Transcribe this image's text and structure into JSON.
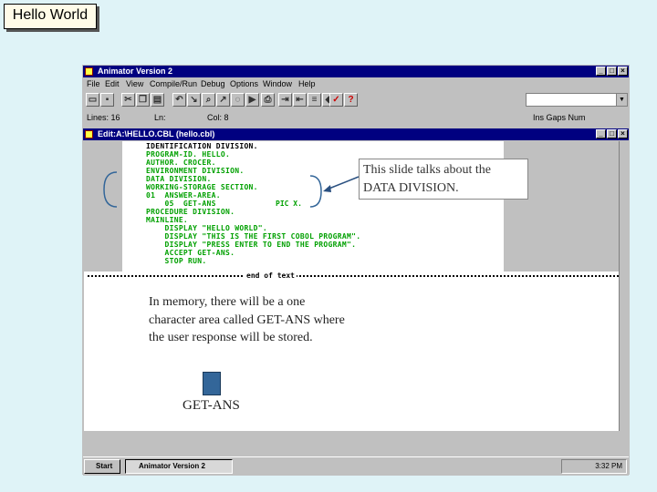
{
  "slide_title": "Hello World",
  "app": {
    "title": "Animator Version 2",
    "window_buttons": [
      "_",
      "□",
      "×"
    ],
    "menu": [
      "File",
      "Edit",
      "View",
      "Compile/Run",
      "Debug",
      "Options",
      "Window",
      "Help"
    ],
    "status": {
      "lines": "Lines: 16",
      "col_label": "Col: 8",
      "line_label": "Ln:",
      "modes": "Ins Gaps Num"
    },
    "editor_title": "Edit:A:\\HELLO.CBL (hello.cbl)",
    "code": [
      "IDENTIFICATION DIVISION.",
      "PROGRAM-ID. HELLO.",
      "AUTHOR. CROCER.",
      "ENVIRONMENT DIVISION.",
      "DATA DIVISION.",
      "WORKING-STORAGE SECTION.",
      "01  ANSWER-AREA.",
      "    05  GET-ANS",
      "PROCEDURE DIVISION.",
      "MAINLINE.",
      "    DISPLAY \"HELLO WORLD\".",
      "    DISPLAY \"THIS IS THE FIRST COBOL PROGRAM\".",
      "    DISPLAY \"PRESS ENTER TO END THE PROGRAM\".",
      "    ACCEPT GET-ANS.",
      "    STOP RUN."
    ],
    "pic_clause": "PIC X.",
    "end_of_text": "end of text",
    "taskbar": {
      "start": "Start",
      "task": "Animator Version 2",
      "clock": "3:32 PM"
    }
  },
  "callout": "This slide talks about the DATA DIVISION.",
  "memory_note": "In memory, there will be a one character area called GET-ANS where the user response will be stored.",
  "memory_label": "GET-ANS",
  "colors": {
    "title_bar": "#000080",
    "code_green": "#00a000",
    "memory_box": "#336699"
  }
}
